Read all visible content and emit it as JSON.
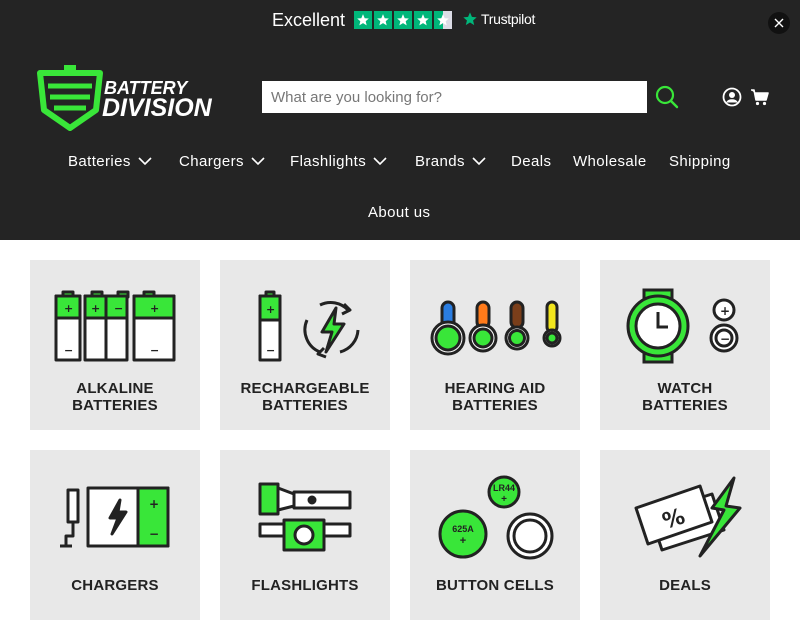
{
  "trustpilot": {
    "rating_text": "Excellent",
    "stars": 4.5,
    "brand": "Trustpilot",
    "icon": "trustpilot-star-icon"
  },
  "colors": {
    "header_bg": "#242424",
    "accent": "#39e639",
    "trustpilot_green": "#00b67a",
    "card_bg": "#e8e8e8"
  },
  "logo": {
    "line1": "BATTERY",
    "line2": "DIVISION"
  },
  "search": {
    "placeholder": "What are you looking for?",
    "value": "",
    "icon": "search-icon"
  },
  "header_icons": {
    "account": "user-account-icon",
    "cart": "cart-icon",
    "close": "close-icon"
  },
  "nav": {
    "items": [
      {
        "label": "Batteries",
        "dropdown": true
      },
      {
        "label": "Chargers",
        "dropdown": true
      },
      {
        "label": "Flashlights",
        "dropdown": true
      },
      {
        "label": "Brands",
        "dropdown": true
      },
      {
        "label": "Deals",
        "dropdown": false
      },
      {
        "label": "Wholesale",
        "dropdown": false
      },
      {
        "label": "Shipping",
        "dropdown": false
      },
      {
        "label": "About us",
        "dropdown": false
      }
    ]
  },
  "categories": [
    {
      "line1": "ALKALINE",
      "line2": "BATTERIES",
      "icon": "alkaline-batteries-icon"
    },
    {
      "line1": "RECHARGEABLE",
      "line2": "BATTERIES",
      "icon": "rechargeable-batteries-icon"
    },
    {
      "line1": "HEARING AID",
      "line2": "BATTERIES",
      "icon": "hearing-aid-batteries-icon"
    },
    {
      "line1": "WATCH",
      "line2": "BATTERIES",
      "icon": "watch-batteries-icon"
    },
    {
      "line1": "CHARGERS",
      "line2": "",
      "icon": "charger-icon"
    },
    {
      "line1": "FLASHLIGHTS",
      "line2": "",
      "icon": "flashlight-icon"
    },
    {
      "line1": "BUTTON CELLS",
      "line2": "",
      "icon": "button-cells-icon",
      "cell_labels": [
        "LR44",
        "625A"
      ]
    },
    {
      "line1": "DEALS",
      "line2": "",
      "icon": "deals-icon"
    }
  ]
}
